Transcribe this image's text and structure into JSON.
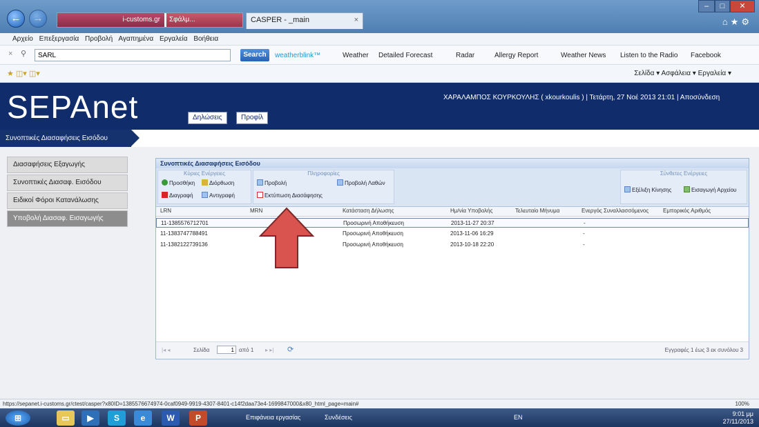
{
  "browser": {
    "tab_site": "i-customs.gr",
    "tab_other": "Σφάλμ...",
    "tab_title": "CASPER - _main",
    "menu": [
      "Αρχείο",
      "Επεξεργασία",
      "Προβολή",
      "Αγαπημένα",
      "Εργαλεία",
      "Βοήθεια"
    ],
    "search_value": "SARL",
    "search_button": "Search",
    "toolbar_links": [
      "weatherblink™",
      "Weather",
      "Detailed Forecast",
      "Radar",
      "Allergy Report",
      "Weather News",
      "Listen to the Radio",
      "Facebook"
    ],
    "toolbar2_right": "Σελίδα ▾   Ασφάλεια ▾   Εργαλεία ▾"
  },
  "header": {
    "logo": "SEPAnet",
    "nav": [
      "Δηλώσεις",
      "Προφίλ"
    ],
    "user_info": "ΧΑΡΑΛΑΜΠΟΣ ΚΟΥΡΚΟΥΛΗΣ ( xkourkoulis ) | Τετάρτη, 27 Νοέ 2013 21:01 | Αποσύνδεση"
  },
  "breadcrumb": "Συνοπτικές Διασαφήσεις Εισόδου",
  "sidebar": {
    "items": [
      {
        "label": "Διασαφήσεις Εξαγωγής",
        "active": false
      },
      {
        "label": "Συνοπτικές Διασαφ. Εισόδου",
        "active": false
      },
      {
        "label": "Ειδικοί Φόροι Κατανάλωσης",
        "active": false
      },
      {
        "label": "Υποβολή Διασαφ. Εισαγωγής",
        "active": true
      }
    ]
  },
  "panel": {
    "title": "Συνοπτικές Διασαφήσεις Εισόδου",
    "group_main": "Κύριες Ενέργειες",
    "group_info": "Πληροφορίες",
    "group_links": "Σύνθετες Ενέργειες",
    "actions": {
      "add": "Προσθήκη",
      "edit": "Διόρθωση",
      "delete": "Διαγραφή",
      "copy": "Αντιγραφή",
      "view": "Προβολή",
      "print": "Εκτύπωση Διασάφησης",
      "view_errors": "Προβολή Λαθών",
      "track": "Εξέλιξη Κίνησης",
      "import_file": "Εισαγωγή Αρχείου"
    },
    "columns": [
      "LRN",
      "MRN",
      "Κατάσταση Δήλωσης",
      "Ημ/νία Υποβολής",
      "Τελευταίο Μήνυμα",
      "Ενεργός Συναλλασσόμενος",
      "Εμπορικός Αριθμός"
    ],
    "rows": [
      {
        "lrn": "11-1385576712701",
        "mrn": "",
        "status": "Προσωρινή Αποθήκευση",
        "date": "2013-11-27 20:37",
        "last": "",
        "trader": "-",
        "ref": ""
      },
      {
        "lrn": "11-1383747788491",
        "mrn": "",
        "status": "Προσωρινή Αποθήκευση",
        "date": "2013-11-06 16:29",
        "last": "",
        "trader": "-",
        "ref": ""
      },
      {
        "lrn": "11-1382122739136",
        "mrn": "",
        "status": "Προσωρινή Αποθήκευση",
        "date": "2013-10-18 22:20",
        "last": "",
        "trader": "-",
        "ref": ""
      }
    ],
    "pager": {
      "page_label": "Σελίδα",
      "page_value": "1",
      "of_label": "από 1",
      "records": "Εγγραφές 1 έως 3 εκ συνόλου 3"
    }
  },
  "status": {
    "url": "https://sepanet.i-customs.gr/ctest/casper?x80ID=1385576674974-0caf0949-9919-4307-8401-c14f2daa73e4-1699847000&x80_html_page=main#",
    "zoom": "100%"
  },
  "taskbar": {
    "item1": "Επιφάνεια εργασίας",
    "item2": "Συνδέσεις",
    "lang": "EN",
    "time": "9:01 μμ",
    "date": "27/11/2013"
  },
  "colors": {
    "header": "#102c6a",
    "arrow": "#d9534f"
  }
}
